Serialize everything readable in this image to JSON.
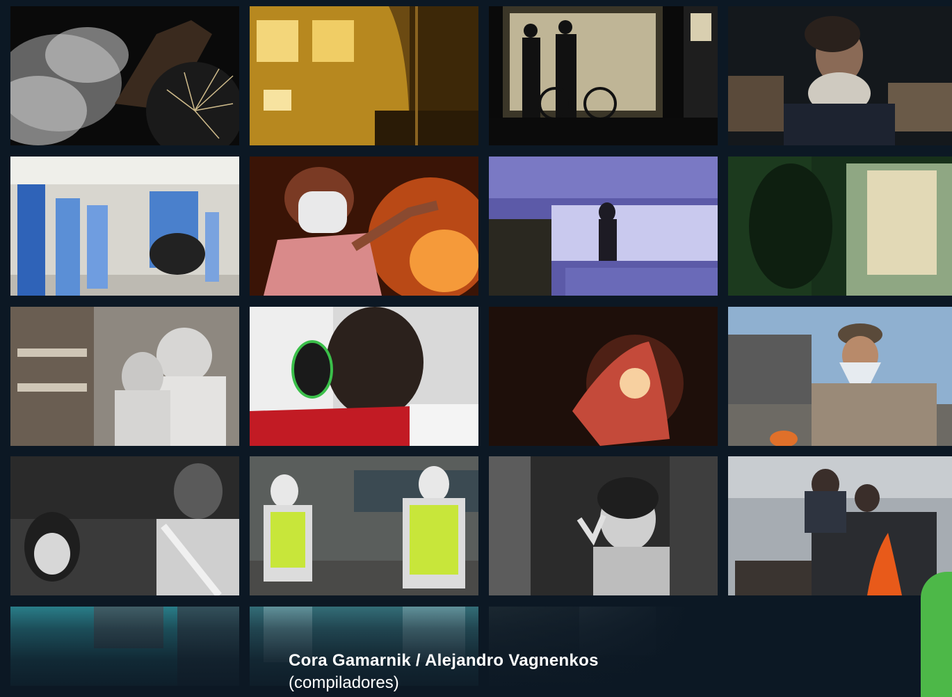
{
  "cover": {
    "authors": "Cora Gamarnik / Alejandro Vagnenkos",
    "role": "(compiladores)"
  },
  "photos": [
    "smoke-fireworks",
    "station-hall",
    "balcony-silhouettes",
    "woman-scarf",
    "nurses-wheelchair",
    "masked-woman-fire",
    "rooftop-dusk",
    "window-curtain",
    "lab-ppe-workers",
    "child-headset",
    "hand-glow",
    "man-bandana-street",
    "woman-mask-bw",
    "sanitation-workers",
    "child-peace-sign",
    "fire-drum"
  ],
  "colors": {
    "background": "#0c1824",
    "accent_green": "#4db848"
  }
}
